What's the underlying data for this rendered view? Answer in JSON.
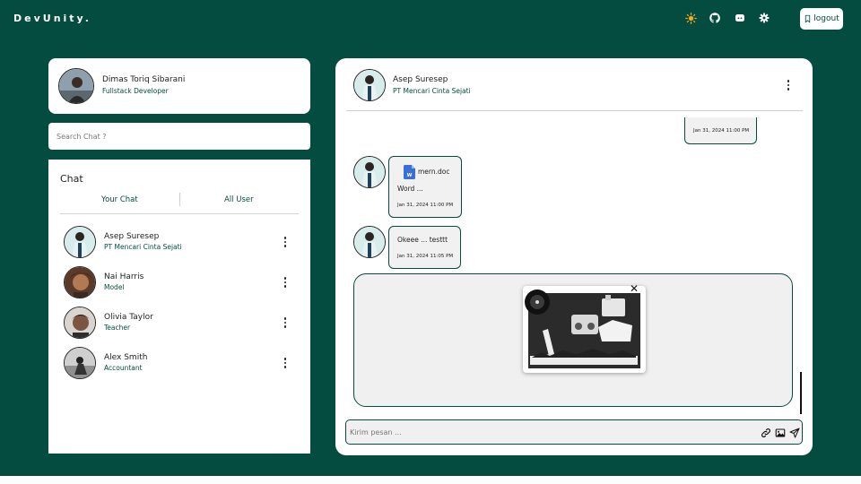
{
  "brand": "DevUnity.",
  "nav": {
    "icons": [
      "theme-sun-icon",
      "github-icon",
      "discord-icon",
      "settings-gear-icon"
    ],
    "logout_label": "logout",
    "accent": "#f5a623"
  },
  "colors": {
    "primary": "#044c3f",
    "surface": "#ffffff",
    "bubble": "#f1f1f1"
  },
  "profile": {
    "name": "Dimas Toriq Sibarani",
    "role": "Fullstack Developer"
  },
  "search": {
    "placeholder": "Search Chat ?"
  },
  "chat_panel": {
    "heading": "Chat",
    "tabs": [
      "Your Chat",
      "All User"
    ],
    "items": [
      {
        "name": "Asep Suresep",
        "subtitle": "PT Mencari Cinta Sejati"
      },
      {
        "name": "Nai Harris",
        "subtitle": "Model"
      },
      {
        "name": "Olivia Taylor",
        "subtitle": "Teacher"
      },
      {
        "name": "Alex Smith",
        "subtitle": "Accountant"
      }
    ]
  },
  "conversation": {
    "contact": {
      "name": "Asep Suresep",
      "subtitle": "PT Mencari Cinta Sejati"
    },
    "messages": [
      {
        "from": "me",
        "time": "Jan 31, 2024 11:00 PM"
      },
      {
        "from": "contact",
        "file_name": "mern.doc",
        "text": "Word ...",
        "time": "Jan 31, 2024 11:00 PM"
      },
      {
        "from": "contact",
        "text": "Okeee ... testtt",
        "time": "Jan 31, 2024 11:05 PM"
      }
    ],
    "input_placeholder": "Kirim pesan ...",
    "input_icons": [
      "attach-link-icon",
      "image-upload-icon",
      "send-icon"
    ]
  }
}
